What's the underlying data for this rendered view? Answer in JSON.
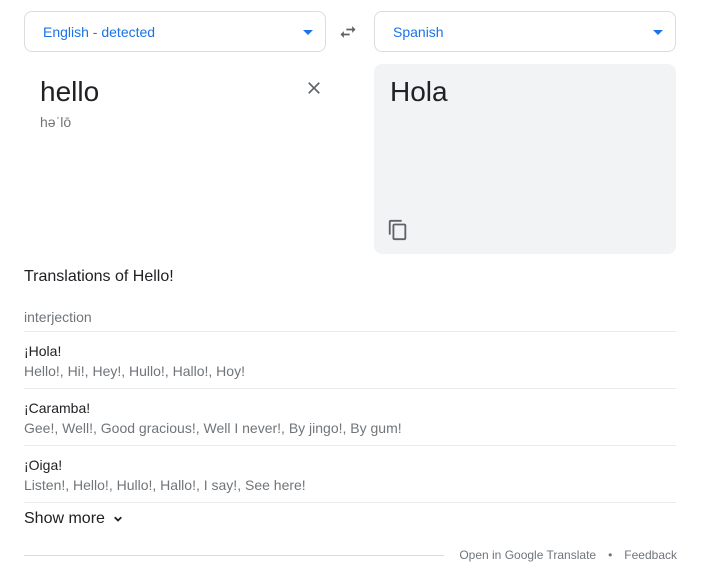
{
  "source_lang": {
    "label": "English - detected"
  },
  "target_lang": {
    "label": "Spanish"
  },
  "source": {
    "text": "hello",
    "phonetic": "həˈlō"
  },
  "target": {
    "text": "Hola"
  },
  "translations": {
    "title": "Translations of Hello!",
    "part_of_speech": "interjection",
    "entries": [
      {
        "word": "¡Hola!",
        "synonyms": "Hello!, Hi!, Hey!, Hullo!, Hallo!, Hoy!"
      },
      {
        "word": "¡Caramba!",
        "synonyms": "Gee!, Well!, Good gracious!, Well I never!, By jingo!, By gum!"
      },
      {
        "word": "¡Oiga!",
        "synonyms": "Listen!, Hello!, Hullo!, Hallo!, I say!, See here!"
      }
    ],
    "show_more": "Show more"
  },
  "footer": {
    "open_link": "Open in Google Translate",
    "separator": "•",
    "feedback": "Feedback"
  },
  "icons": {
    "swap": "swap-arrows-icon",
    "clear": "close-icon",
    "copy": "copy-icon",
    "dropdown": "caret-down-icon",
    "show_more": "chevron-down-icon"
  },
  "colors": {
    "accent": "#1a73e8",
    "panel_bg": "#f1f3f4",
    "muted": "#70757a",
    "text": "#202124"
  }
}
